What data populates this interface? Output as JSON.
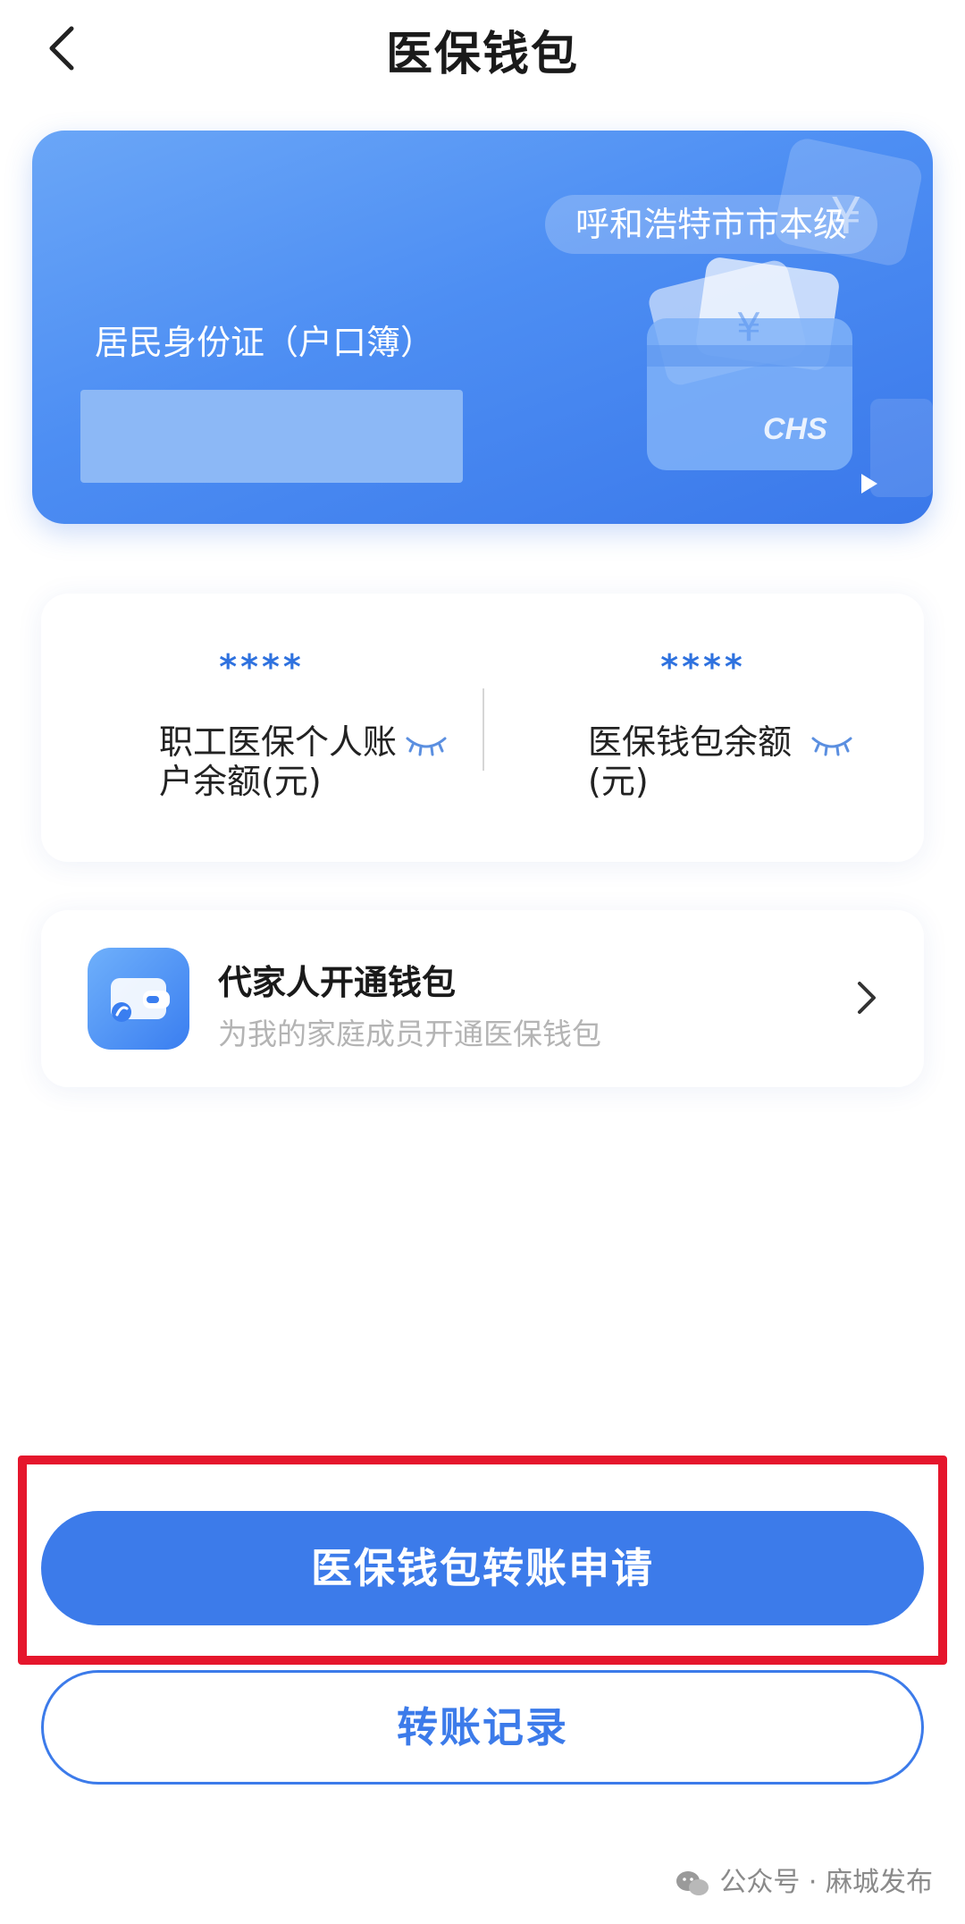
{
  "header": {
    "title": "医保钱包"
  },
  "card": {
    "region": "呼和浩特市市本级",
    "id_type": "居民身份证（户口簿）",
    "logo_text": "CHS"
  },
  "balances": [
    {
      "masked_value": "****",
      "label": "职工医保个人账户余额(元)"
    },
    {
      "masked_value": "****",
      "label": "医保钱包余额(元)"
    }
  ],
  "family_wallet": {
    "title": "代家人开通钱包",
    "subtitle": "为我的家庭成员开通医保钱包"
  },
  "actions": {
    "transfer_apply": "医保钱包转账申请",
    "transfer_records": "转账记录"
  },
  "watermark": {
    "text": "公众号 · 麻城发布"
  },
  "colors": {
    "primary": "#3c7bea",
    "card_gradient_start": "#6aa6f7",
    "card_gradient_end": "#3a78ea",
    "highlight": "#e5162c"
  },
  "icons": [
    "back-chevron-icon",
    "eye-closed-icon",
    "wallet-icon",
    "chevron-right-icon",
    "play-icon",
    "wechat-icon"
  ]
}
